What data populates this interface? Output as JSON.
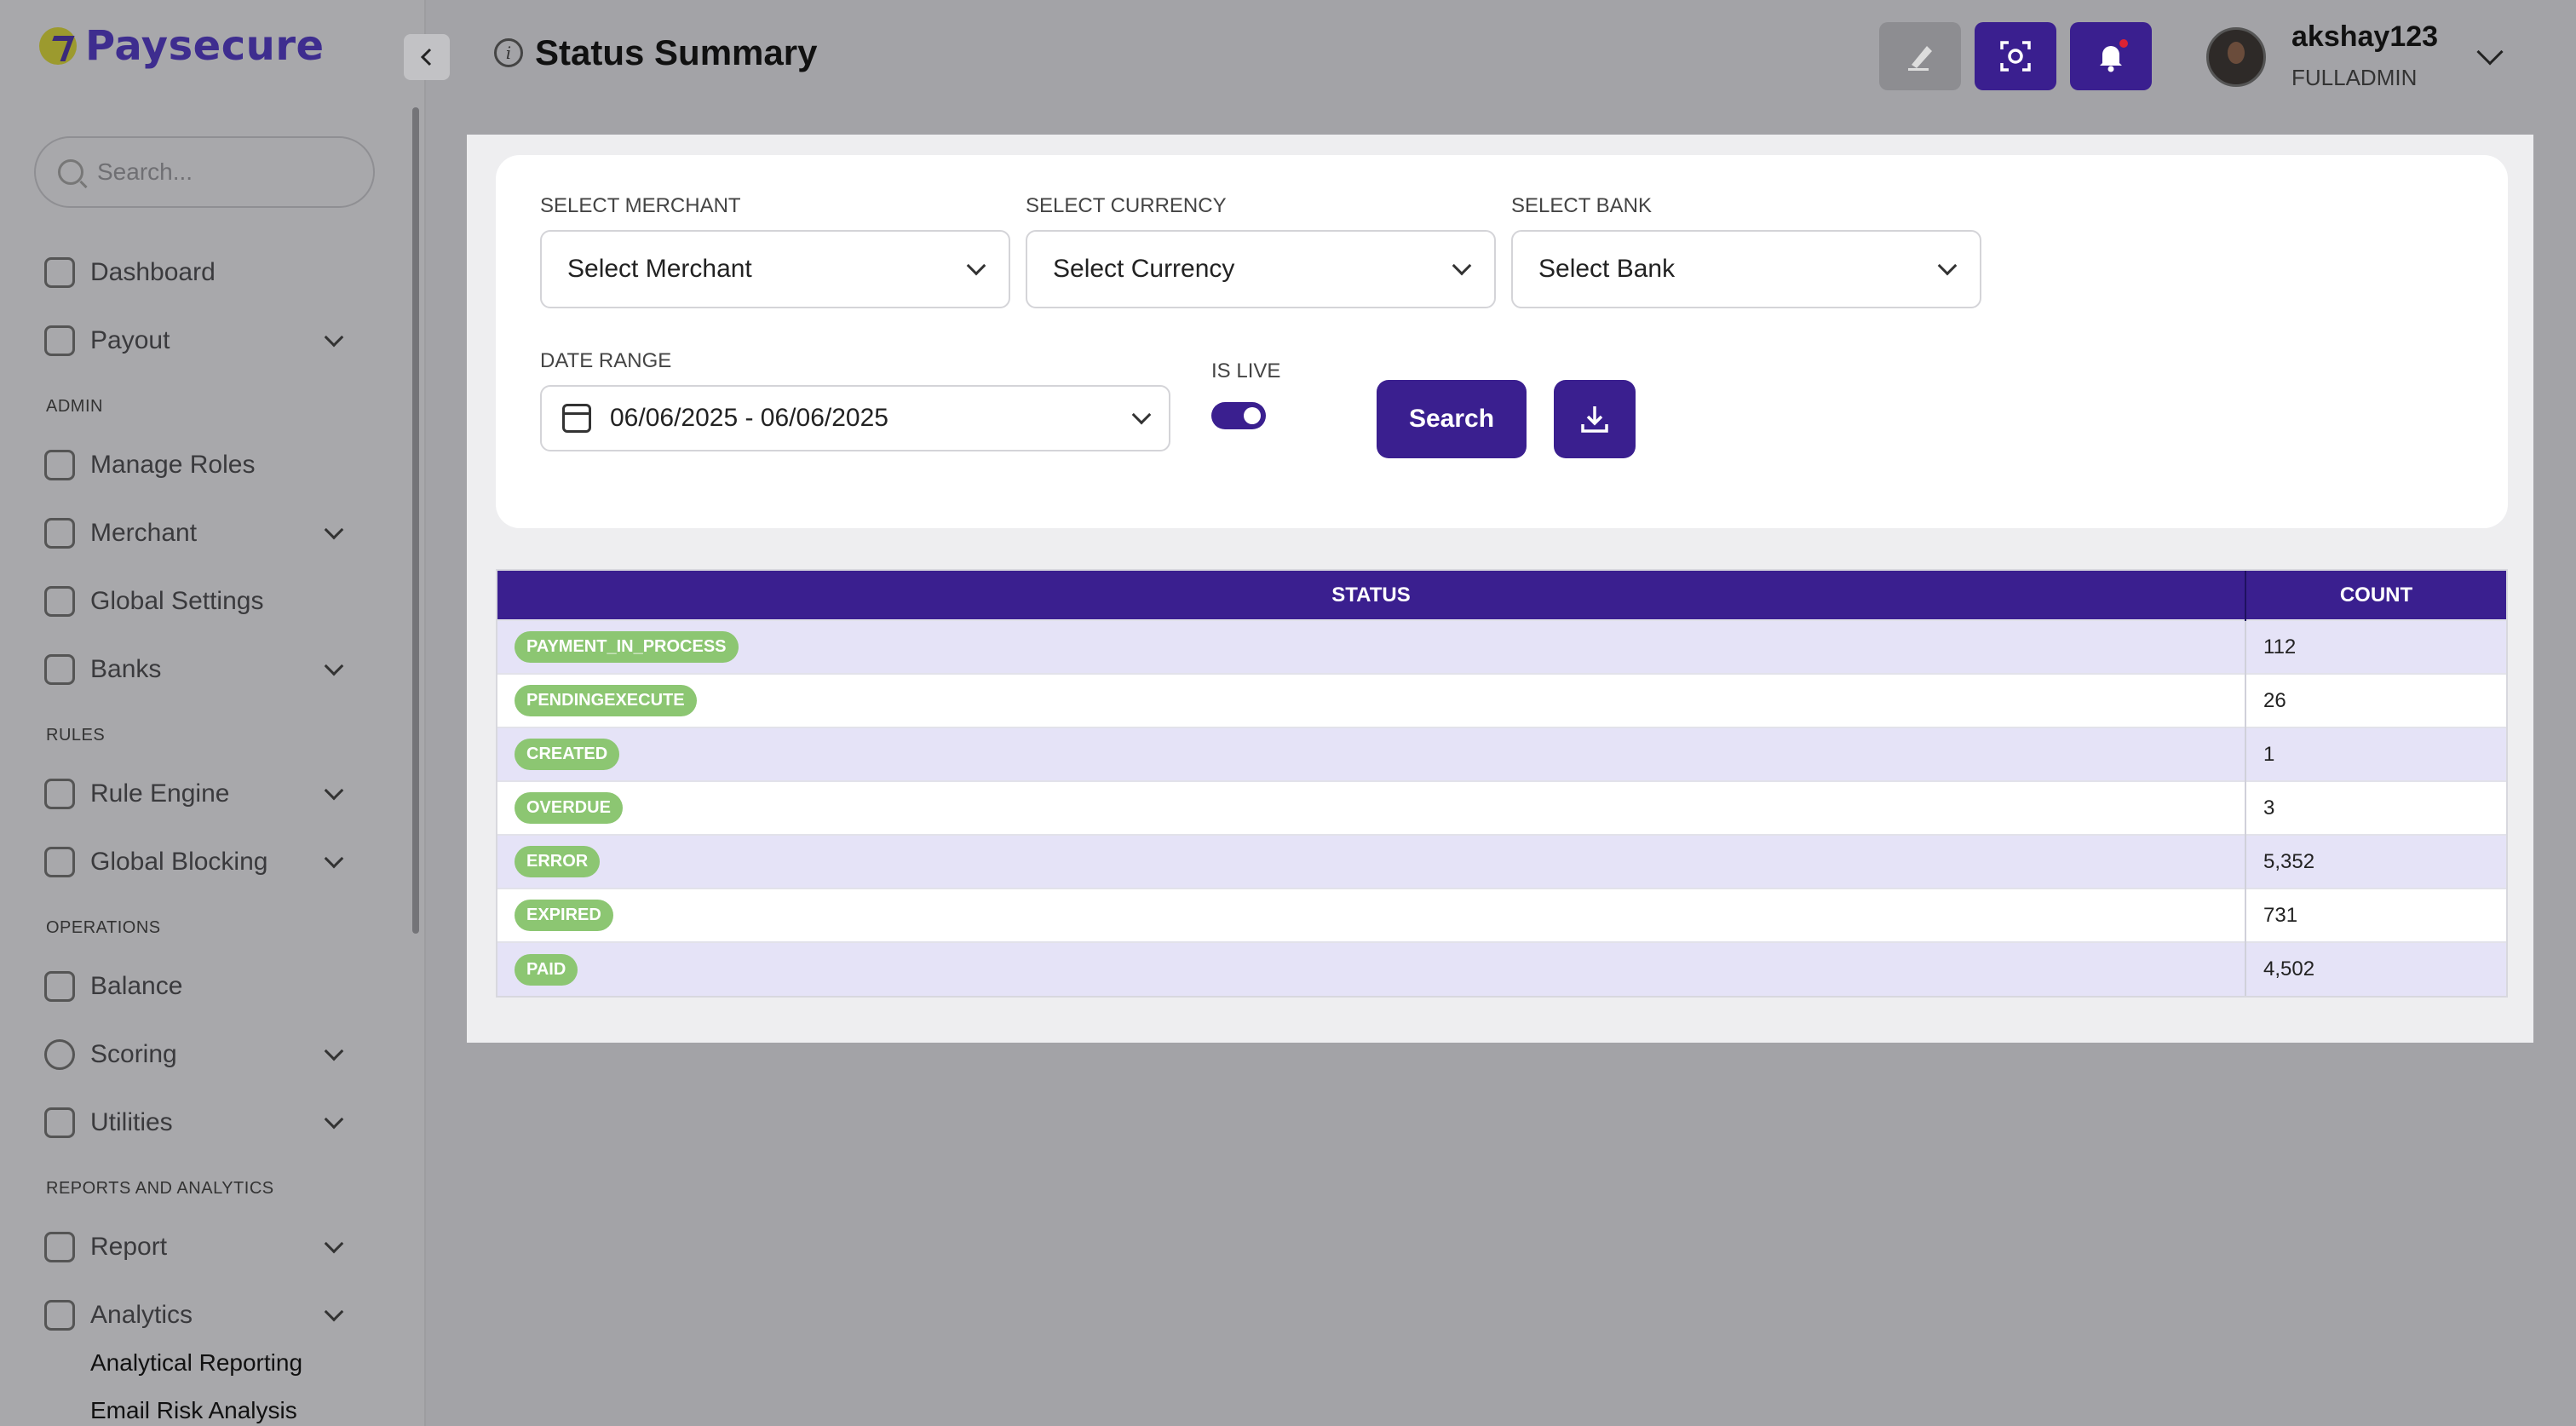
{
  "app": {
    "logo_text": "Paysecure"
  },
  "sidebar": {
    "search_placeholder": "Search...",
    "sections": {
      "admin": "ADMIN",
      "rules": "RULES",
      "operations": "OPERATIONS",
      "reports": "REPORTS AND ANALYTICS"
    },
    "items": {
      "dashboard": "Dashboard",
      "payout": "Payout",
      "manage_roles": "Manage Roles",
      "merchant": "Merchant",
      "global_settings": "Global Settings",
      "banks": "Banks",
      "rule_engine": "Rule Engine",
      "global_blocking": "Global Blocking",
      "balance": "Balance",
      "scoring": "Scoring",
      "utilities": "Utilities",
      "report": "Report",
      "analytics": "Analytics"
    },
    "sub_items": {
      "analytical_reporting": "Analytical Reporting",
      "email_risk_analysis": "Email Risk Analysis"
    }
  },
  "header": {
    "title": "Status Summary",
    "info_icon": "i",
    "user": {
      "name": "akshay123",
      "role": "FULLADMIN"
    }
  },
  "filters": {
    "merchant": {
      "label": "SELECT MERCHANT",
      "value": "Select Merchant"
    },
    "currency": {
      "label": "SELECT CURRENCY",
      "value": "Select Currency"
    },
    "bank": {
      "label": "SELECT BANK",
      "value": "Select Bank"
    },
    "date_range": {
      "label": "DATE RANGE",
      "value": "06/06/2025 - 06/06/2025"
    },
    "is_live": {
      "label": "IS LIVE",
      "on": true
    },
    "search_button": "Search"
  },
  "table": {
    "headers": {
      "status": "STATUS",
      "count": "COUNT"
    },
    "rows": [
      {
        "status": "PAYMENT_IN_PROCESS",
        "count": "112"
      },
      {
        "status": "PENDINGEXECUTE",
        "count": "26"
      },
      {
        "status": "CREATED",
        "count": "1"
      },
      {
        "status": "OVERDUE",
        "count": "3"
      },
      {
        "status": "ERROR",
        "count": "5,352"
      },
      {
        "status": "EXPIRED",
        "count": "731"
      },
      {
        "status": "PAID",
        "count": "4,502"
      }
    ]
  },
  "colors": {
    "brand": "#3a1f8f",
    "badge": "#8cc672",
    "row_alt": "#e5e3f7"
  }
}
